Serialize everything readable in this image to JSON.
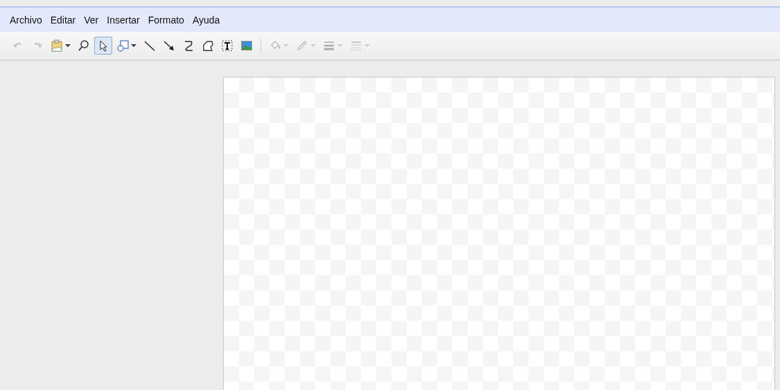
{
  "menu": [
    {
      "label": "Archivo"
    },
    {
      "label": "Editar"
    },
    {
      "label": "Ver"
    },
    {
      "label": "Insertar"
    },
    {
      "label": "Formato"
    },
    {
      "label": "Ayuda"
    }
  ],
  "toolbar": [
    {
      "kind": "undo",
      "disabled": true,
      "selected": false,
      "dropdown": false
    },
    {
      "kind": "redo",
      "disabled": true,
      "selected": false,
      "dropdown": false
    },
    {
      "kind": "clipart",
      "disabled": false,
      "selected": false,
      "dropdown": true
    },
    {
      "kind": "zoom",
      "disabled": false,
      "selected": false,
      "dropdown": false
    },
    {
      "kind": "select",
      "disabled": false,
      "selected": true,
      "dropdown": false
    },
    {
      "kind": "shape",
      "disabled": false,
      "selected": false,
      "dropdown": true
    },
    {
      "kind": "line",
      "disabled": false,
      "selected": false,
      "dropdown": false
    },
    {
      "kind": "arrow",
      "disabled": false,
      "selected": false,
      "dropdown": false
    },
    {
      "kind": "curve",
      "disabled": false,
      "selected": false,
      "dropdown": false
    },
    {
      "kind": "polyline",
      "disabled": false,
      "selected": false,
      "dropdown": false
    },
    {
      "kind": "textbox",
      "disabled": false,
      "selected": false,
      "dropdown": false
    },
    {
      "kind": "image",
      "disabled": false,
      "selected": false,
      "dropdown": false
    },
    {
      "kind": "separator"
    },
    {
      "kind": "fill",
      "disabled": true,
      "selected": false,
      "dropdown": true
    },
    {
      "kind": "pen",
      "disabled": true,
      "selected": false,
      "dropdown": true
    },
    {
      "kind": "weight",
      "disabled": true,
      "selected": false,
      "dropdown": true
    },
    {
      "kind": "dash",
      "disabled": true,
      "selected": false,
      "dropdown": true
    }
  ]
}
